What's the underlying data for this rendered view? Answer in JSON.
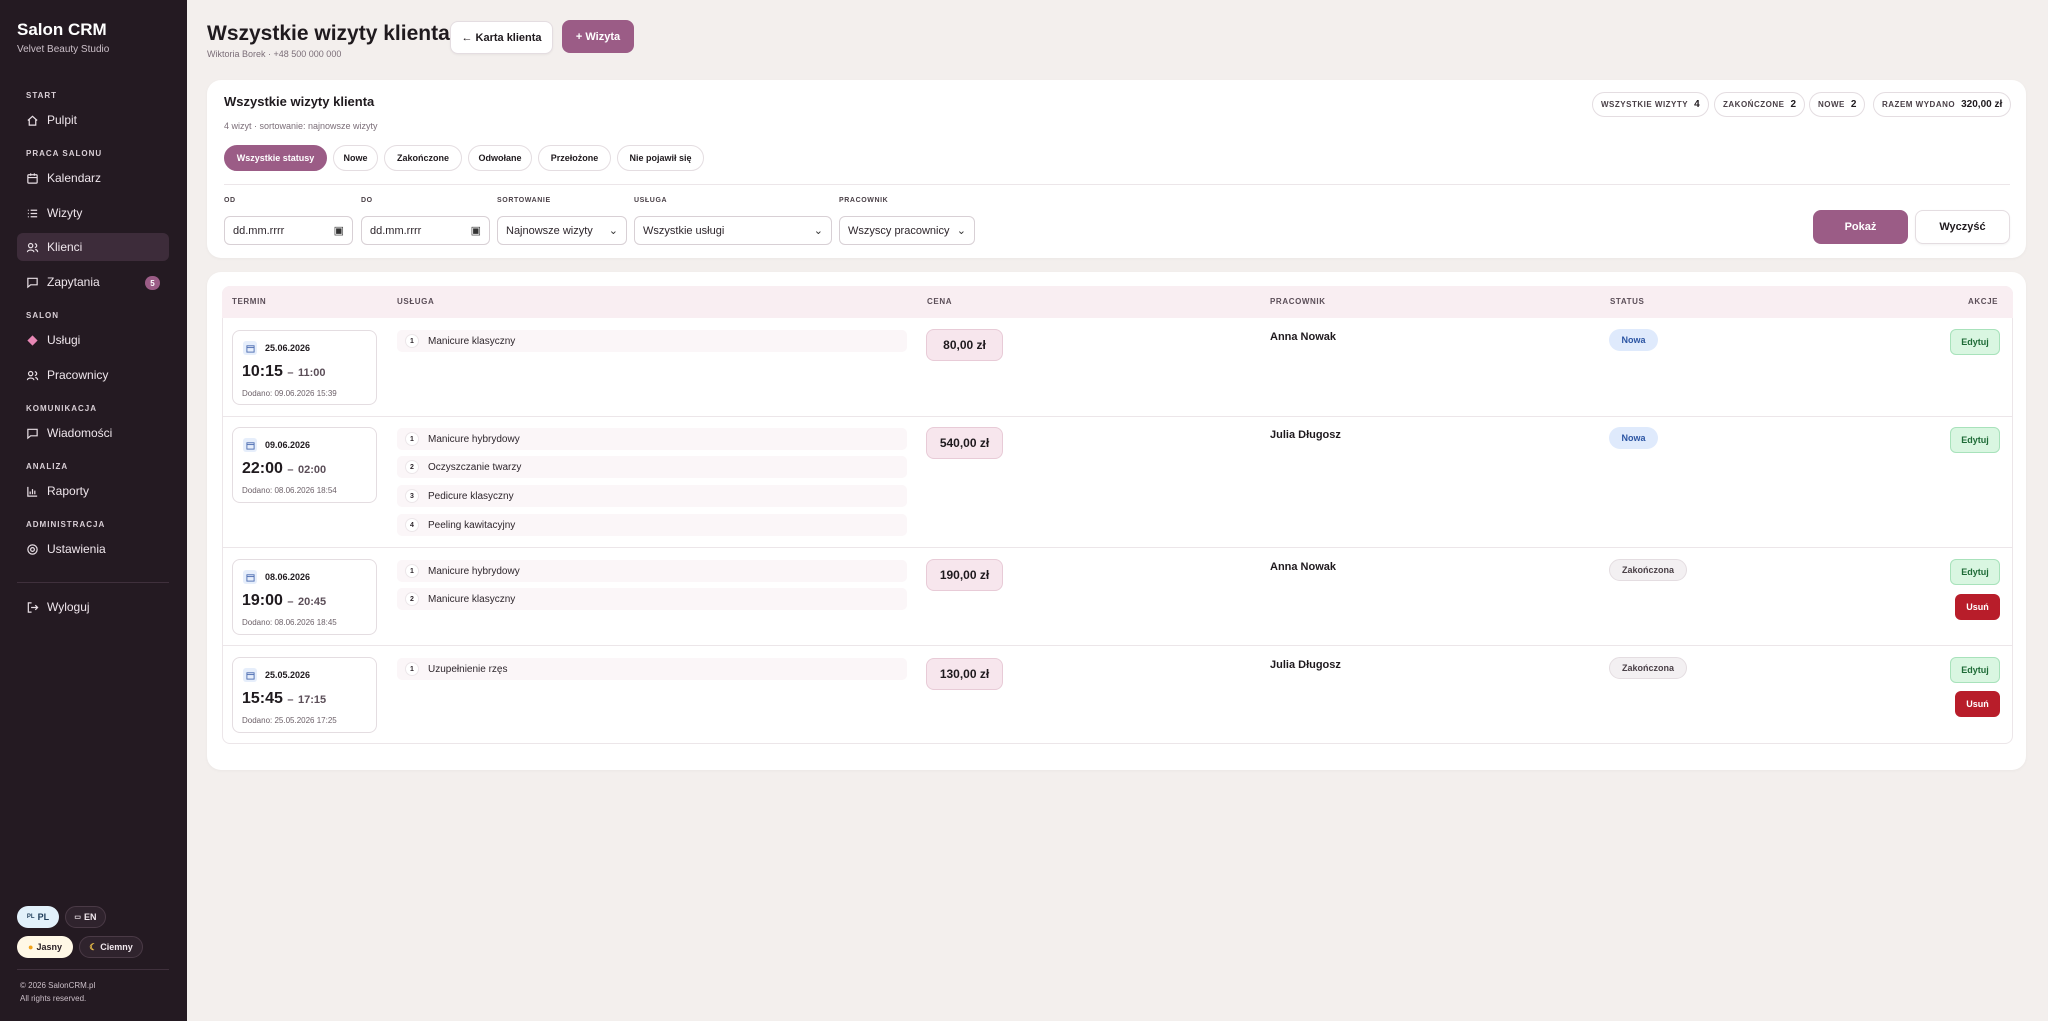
{
  "sidebar": {
    "brand_title": "Salon CRM",
    "brand_subtitle": "Velvet Beauty Studio",
    "sections": {
      "start": "START",
      "praca": "PRACA SALONU",
      "salon": "SALON",
      "komunikacja": "KOMUNIKACJA",
      "analiza": "ANALIZA",
      "administracja": "ADMINISTRACJA"
    },
    "items": {
      "pulpit": "Pulpit",
      "kalendarz": "Kalendarz",
      "wizyty": "Wizyty",
      "klienci": "Klienci",
      "zapytania": "Zapytania",
      "zapytania_badge": "5",
      "uslugi": "Usługi",
      "pracownicy": "Pracownicy",
      "wiadomosci": "Wiadomości",
      "raporty": "Raporty",
      "ustawienia": "Ustawienia",
      "wyloguj": "Wyloguj"
    },
    "lang_pl": "PL",
    "lang_pl_flag": "PL",
    "lang_en": "EN",
    "theme_light": "Jasny",
    "theme_dark": "Ciemny",
    "copyright": "© 2026 SalonCRM.pl",
    "rights": "All rights reserved."
  },
  "header": {
    "title": "Wszystkie wizyty klienta",
    "subtitle": "Wiktoria Borek · +48 500 000 000",
    "back_button": "← Karta klienta",
    "add_button": "+ Wizyta"
  },
  "filters": {
    "title": "Wszystkie wizyty klienta",
    "subtitle": "4 wizyt · sortowanie: najnowsze wizyty",
    "stats": [
      {
        "label": "WSZYSTKIE WIZYTY",
        "value": "4"
      },
      {
        "label": "ZAKOŃCZONE",
        "value": "2"
      },
      {
        "label": "NOWE",
        "value": "2"
      },
      {
        "label": "RAZEM WYDANO",
        "value": "320,00 zł"
      }
    ],
    "chips": [
      "Wszystkie statusy",
      "Nowe",
      "Zakończone",
      "Odwołane",
      "Przełożone",
      "Nie pojawił się"
    ],
    "labels": {
      "od": "OD",
      "do": "DO",
      "sort": "SORTOWANIE",
      "usluga": "USŁUGA",
      "pracownik": "PRACOWNIK"
    },
    "od_value": "dd.mm.rrrr",
    "do_value": "dd.mm.rrrr",
    "sort_value": "Najnowsze wizyty",
    "usluga_value": "Wszystkie usługi",
    "pracownik_value": "Wszyscy pracownicy",
    "show_button": "Pokaż",
    "clear_button": "Wyczyść"
  },
  "table": {
    "headers": {
      "termin": "TERMIN",
      "usluga": "USŁUGA",
      "cena": "CENA",
      "pracownik": "PRACOWNIK",
      "status": "STATUS",
      "akcje": "AKCJE"
    },
    "edit_label": "Edytuj",
    "delete_label": "Usuń",
    "rows": [
      {
        "date": "25.06.2026",
        "start": "10:15",
        "end": "11:00",
        "added": "Dodano: 09.06.2026 15:39",
        "services": [
          "Manicure klasyczny"
        ],
        "price": "80,00 zł",
        "employee": "Anna Nowak",
        "status": "Nowa"
      },
      {
        "date": "09.06.2026",
        "start": "22:00",
        "end": "02:00",
        "added": "Dodano: 08.06.2026 18:54",
        "services": [
          "Manicure hybrydowy",
          "Oczyszczanie twarzy",
          "Pedicure klasyczny",
          "Peeling kawitacyjny"
        ],
        "price": "540,00 zł",
        "employee": "Julia Długosz",
        "status": "Nowa"
      },
      {
        "date": "08.06.2026",
        "start": "19:00",
        "end": "20:45",
        "added": "Dodano: 08.06.2026 18:45",
        "services": [
          "Manicure hybrydowy",
          "Manicure klasyczny"
        ],
        "price": "190,00 zł",
        "employee": "Anna Nowak",
        "status": "Zakończona"
      },
      {
        "date": "25.05.2026",
        "start": "15:45",
        "end": "17:15",
        "added": "Dodano: 25.05.2026 17:25",
        "services": [
          "Uzupełnienie rzęs"
        ],
        "price": "130,00 zł",
        "employee": "Julia Długosz",
        "status": "Zakończona"
      }
    ]
  },
  "colors": {
    "accent": "#9b5c86",
    "sidebar": "#241a22",
    "danger": "#b81d2a",
    "success": "#d9f6e1"
  }
}
